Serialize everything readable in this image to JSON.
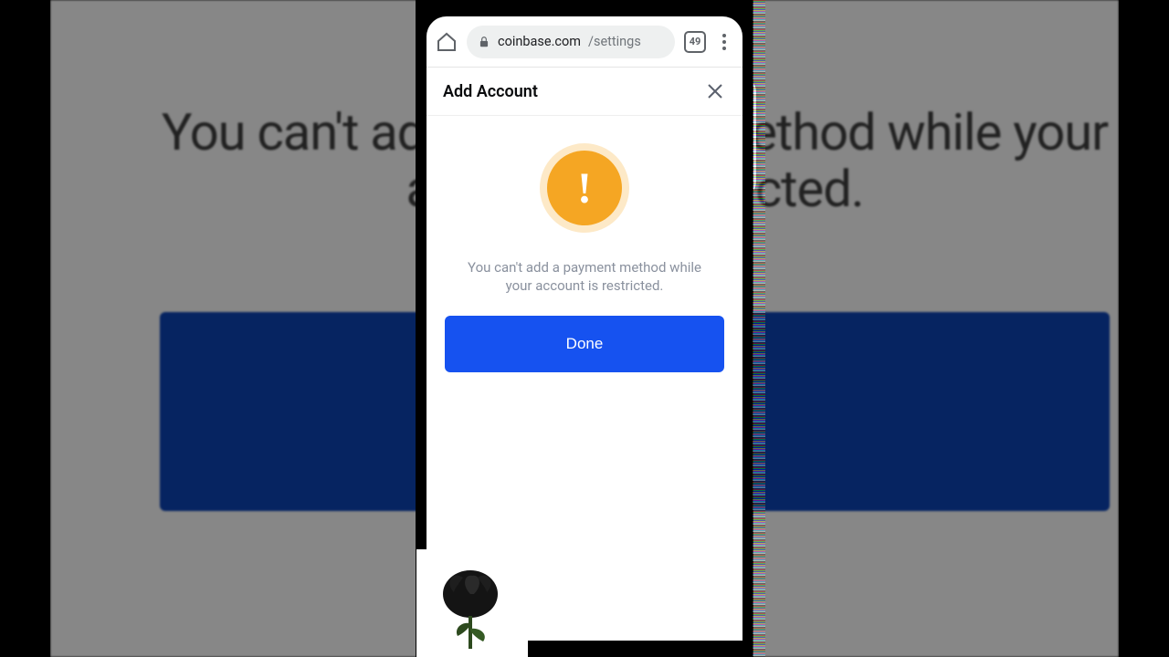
{
  "background": {
    "message": "You can't add a payment method while your account is restricted."
  },
  "browser": {
    "url_domain": "coinbase.com",
    "url_path": "/settings",
    "tab_count": "49"
  },
  "modal": {
    "title": "Add Account",
    "warning_glyph": "!",
    "message": "You can't add a payment method while your account is restricted.",
    "done_label": "Done"
  },
  "colors": {
    "accent": "#1652f0",
    "warning": "#f5a623"
  }
}
